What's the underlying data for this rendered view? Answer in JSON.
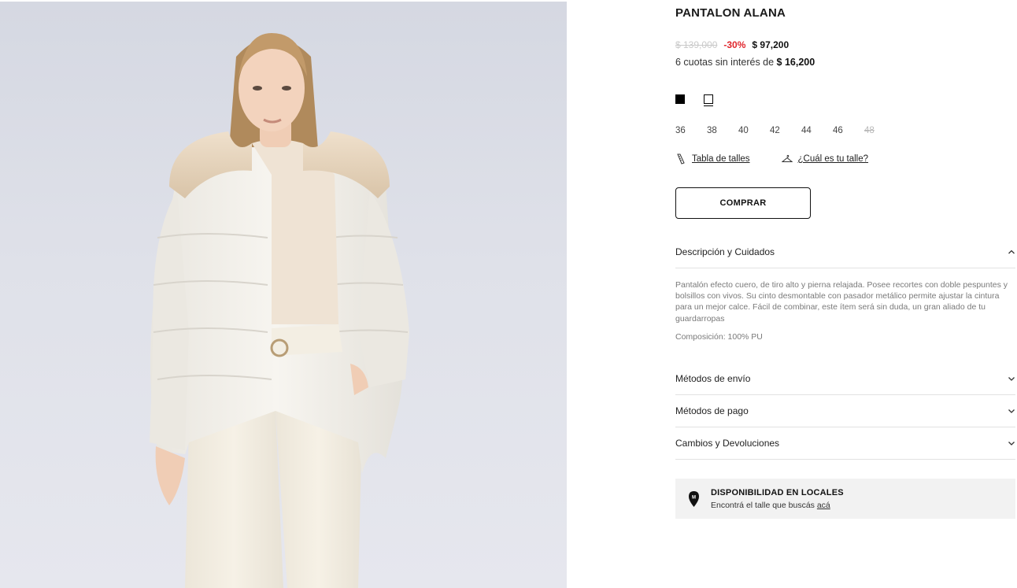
{
  "product": {
    "title": "PANTALON ALANA",
    "old_price": "$ 139,000",
    "discount": "-30%",
    "final_price": "$ 97,200",
    "installments_text": "6 cuotas sin interés de ",
    "installments_amount": "$ 16,200"
  },
  "colors": [
    {
      "name": "black-swatch",
      "hex": "#000000",
      "selected": false
    },
    {
      "name": "white-swatch",
      "hex": "#ffffff",
      "selected": true
    }
  ],
  "sizes": [
    {
      "label": "36",
      "available": true
    },
    {
      "label": "38",
      "available": true
    },
    {
      "label": "40",
      "available": true
    },
    {
      "label": "42",
      "available": true
    },
    {
      "label": "44",
      "available": true
    },
    {
      "label": "46",
      "available": true
    },
    {
      "label": "48",
      "available": false
    }
  ],
  "links": {
    "size_table": "Tabla de talles",
    "size_table_icon": "ruler-icon",
    "find_size": "¿Cuál es tu talle?",
    "find_size_icon": "hanger-icon"
  },
  "buy_label": "COMPRAR",
  "accordions": {
    "description": {
      "title": "Descripción y Cuidados",
      "expanded": true,
      "text": "Pantalón efecto cuero, de tiro alto y pierna relajada. Posee recortes con doble pespuntes y bolsillos con vivos. Su cinto desmontable con pasador metálico permite ajustar la cintura para un mejor calce. Fácil de combinar, este ítem será sin duda, un gran aliado de tu guardarropas",
      "composition": "Composición: 100% PU"
    },
    "shipping": {
      "title": "Métodos de envío",
      "expanded": false
    },
    "payment": {
      "title": "Métodos de pago",
      "expanded": false
    },
    "returns": {
      "title": "Cambios y Devoluciones",
      "expanded": false
    }
  },
  "availability": {
    "title": "DISPONIBILIDAD EN LOCALES",
    "subtitle": "Encontrá el talle que buscás ",
    "link": "acá",
    "icon": "store-pin-icon"
  },
  "colors_theme": {
    "discount": "#e0242b",
    "old_price": "#c9c9c9",
    "panel_bg": "#f2f2f2"
  }
}
